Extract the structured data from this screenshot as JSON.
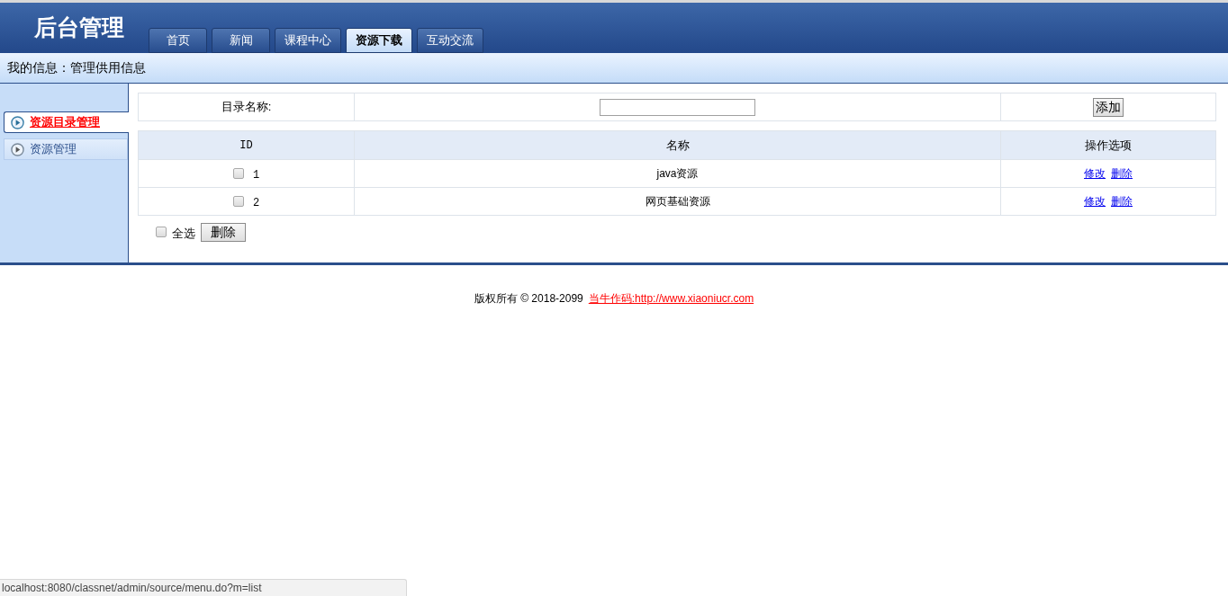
{
  "header": {
    "title": "后台管理"
  },
  "tabs": [
    {
      "label": "首页",
      "selected": false
    },
    {
      "label": "新闻",
      "selected": false
    },
    {
      "label": "课程中心",
      "selected": false
    },
    {
      "label": "资源下载",
      "selected": true
    },
    {
      "label": "互动交流",
      "selected": false
    }
  ],
  "info_bar": {
    "text": "我的信息：管理供用信息"
  },
  "sidebar": {
    "items": [
      {
        "label": "资源目录管理",
        "selected": true
      },
      {
        "label": "资源管理",
        "selected": false
      }
    ]
  },
  "form": {
    "label": "目录名称:",
    "add_button": "添加"
  },
  "table": {
    "columns": [
      "ID",
      "名称",
      "操作选项"
    ],
    "rows": [
      {
        "checked": false,
        "id": "1",
        "name": "java资源",
        "actions": [
          "修改",
          "删除"
        ]
      },
      {
        "checked": false,
        "id": "2",
        "name": "网页基础资源",
        "actions": [
          "修改",
          "删除"
        ]
      }
    ]
  },
  "select_all": {
    "label": "全选",
    "checked": false
  },
  "delete_button": "删除",
  "footer": {
    "text": "版权所有 © 2018-2099",
    "link": "当牛作码:http://www.xiaoniucr.com"
  },
  "status_bar": {
    "url": "localhost:8080/classnet/admin/source/menu.do?m=list"
  }
}
